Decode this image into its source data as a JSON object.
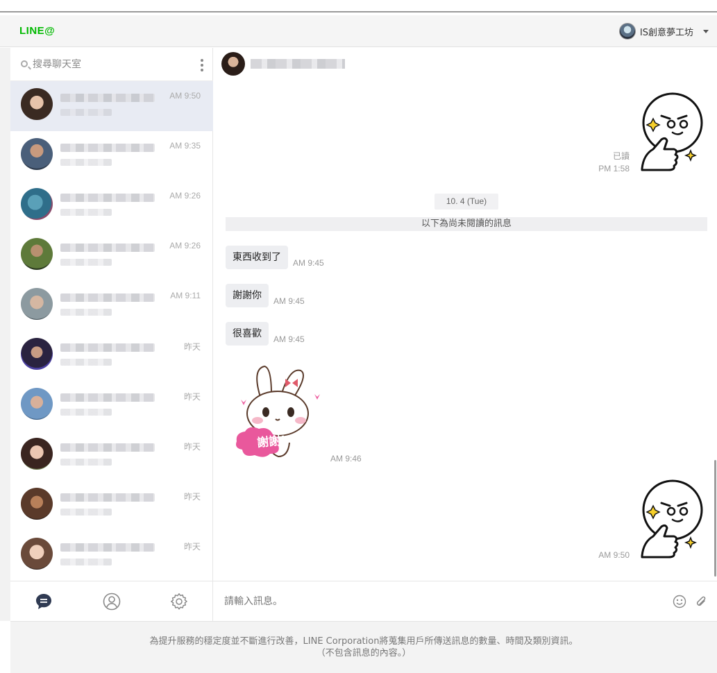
{
  "header": {
    "logo": "LINE@",
    "account_name": "IS創意夢工坊"
  },
  "sidebar": {
    "search_placeholder": "搜尋聊天室",
    "chats": [
      {
        "time": "AM 9:50",
        "active": true
      },
      {
        "time": "AM 9:35",
        "active": false
      },
      {
        "time": "AM 9:26",
        "active": false
      },
      {
        "time": "AM 9:26",
        "active": false
      },
      {
        "time": "AM 9:11",
        "active": false
      },
      {
        "time": "昨天",
        "active": false
      },
      {
        "time": "昨天",
        "active": false
      },
      {
        "time": "昨天",
        "active": false
      },
      {
        "time": "昨天",
        "active": false
      },
      {
        "time": "昨天",
        "active": false
      }
    ],
    "footer_icons": [
      "chat-bubble-icon",
      "contact-icon",
      "settings-gear-icon"
    ]
  },
  "conversation": {
    "first_sticker": {
      "read_label": "已讀",
      "time": "PM 1:58"
    },
    "date_divider": "10. 4 (Tue)",
    "unread_divider": "以下為尚未閱讀的訊息",
    "messages": [
      {
        "text": "東西收到了",
        "time": "AM 9:45"
      },
      {
        "text": "謝謝你",
        "time": "AM 9:45"
      },
      {
        "text": "很喜歡",
        "time": "AM 9:45"
      }
    ],
    "bunny_sticker": {
      "text": "謝謝!",
      "time": "AM 9:46"
    },
    "last_sticker": {
      "time": "AM 9:50"
    }
  },
  "composer": {
    "placeholder": "請輸入訊息。"
  },
  "notice": {
    "line1": "為提升服務的穩定度並不斷進行改善，LINE Corporation將蒐集用戶所傳送訊息的數量、時間及類別資訊。",
    "line2": "（不包含訊息的內容。）"
  },
  "colors": {
    "brand_green": "#00b900",
    "active_row": "#e8ebf3",
    "bubble": "#edeef1"
  }
}
